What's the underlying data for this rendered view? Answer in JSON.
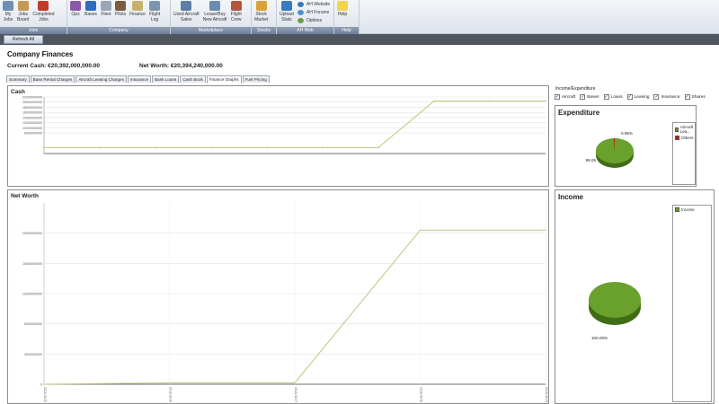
{
  "ribbon": {
    "groups": [
      {
        "label": "Jobs",
        "items": [
          {
            "label": "My\nJobs",
            "icon": "clipboard-icon",
            "color": "#6d8fb5"
          },
          {
            "label": "Jobs\nBoard",
            "icon": "jobs-board-icon",
            "color": "#c79a52"
          },
          {
            "label": "Completed\nJobs",
            "icon": "checkmark-icon",
            "color": "#c23b2a"
          }
        ]
      },
      {
        "label": "Company",
        "items": [
          {
            "label": "Ops",
            "icon": "ops-icon",
            "color": "#8a5aa8"
          },
          {
            "label": "Bases",
            "icon": "globe-icon",
            "color": "#2d6cc0"
          },
          {
            "label": "Fleet",
            "icon": "airplane-icon",
            "color": "#9aa7b8"
          },
          {
            "label": "Pilots",
            "icon": "pilot-icon",
            "color": "#7c5b42"
          },
          {
            "label": "Finance",
            "icon": "money-icon",
            "color": "#c8b26a"
          },
          {
            "label": "Flight\nLog",
            "icon": "logbook-icon",
            "color": "#7d94b3"
          }
        ]
      },
      {
        "label": "Marketplace",
        "items": [
          {
            "label": "Used Aircraft\nSales",
            "icon": "used-aircraft-icon",
            "color": "#5d7fa6"
          },
          {
            "label": "Lease/Buy\nNew Aircraft",
            "icon": "new-aircraft-icon",
            "color": "#6b8db3"
          },
          {
            "label": "Flight\nCrew",
            "icon": "crew-icon",
            "color": "#b5553d"
          }
        ]
      },
      {
        "label": "Stocks",
        "items": [
          {
            "label": "Stock\nMarket",
            "icon": "stock-market-icon",
            "color": "#d9a33a"
          }
        ]
      },
      {
        "label": "AH Web",
        "items": [
          {
            "label": "Upload\nStats",
            "icon": "upload-icon",
            "color": "#3b79c2"
          }
        ],
        "mini": [
          {
            "label": "AH Website",
            "icon": "website-icon",
            "color": "#3b79c2"
          },
          {
            "label": "AH Forums",
            "icon": "forums-icon",
            "color": "#4d8fd0"
          },
          {
            "label": "Options",
            "icon": "options-icon",
            "color": "#6a9a4c"
          }
        ]
      },
      {
        "label": "Help",
        "items": [
          {
            "label": "Help",
            "icon": "lightbulb-icon",
            "color": "#f2d54a"
          }
        ]
      }
    ]
  },
  "toolbar": {
    "refresh_label": "Refresh All"
  },
  "page": {
    "title": "Company Finances",
    "current_cash": "Current Cash: €20,392,000,000.00",
    "net_worth": "Net Worth: €20,394,240,000.00"
  },
  "tabs": [
    "Summary",
    "Base Rental Charges",
    "Aircraft Leasing Charges",
    "Insurance",
    "Bank Loans",
    "Cash Book",
    "Finance Graphs",
    "Fuel Pricing"
  ],
  "active_tab": "Finance Graphs",
  "income_expenditure": {
    "label": "Income/Expenditure",
    "filters": [
      {
        "label": "Aircraft",
        "checked": true
      },
      {
        "label": "Bases",
        "checked": true
      },
      {
        "label": "Loans",
        "checked": true
      },
      {
        "label": "Leasing",
        "checked": true
      },
      {
        "label": "Insurance",
        "checked": true
      },
      {
        "label": "Shares",
        "checked": true
      }
    ]
  },
  "colors": {
    "line": "#b9c97a",
    "pie_green": "#6aa12c",
    "pie_red": "#b01818"
  },
  "chart_data": [
    {
      "type": "line",
      "title": "Cash",
      "x": [
        0,
        1,
        2,
        3,
        4,
        5,
        6,
        7,
        8,
        9
      ],
      "values": [
        2300000000,
        2300000000,
        2300000000,
        2300000000,
        2300000000,
        2300000000,
        2300000000,
        20392000000,
        20392000000,
        20392000000
      ],
      "ylim": [
        0,
        22000000000
      ],
      "yticks": [
        "22000000000",
        "20000000000",
        "18000000000",
        "16000000000",
        "14000000000",
        "12000000000",
        "10000000000",
        "8000000000"
      ],
      "grid": true
    },
    {
      "type": "line",
      "title": "Net Worth",
      "x": [
        0,
        1,
        2,
        3,
        4
      ],
      "values": [
        0,
        180000000,
        180000000,
        20394240000,
        20394240000
      ],
      "ylim": [
        0,
        24000000000
      ],
      "yticks": [
        "20000000000",
        "16000000000",
        "12000000000",
        "8000000000",
        "4000000000",
        "0"
      ],
      "xticks": [
        "2018.08.05",
        "2018.08.06",
        "2018.08.07",
        "2018.08.08",
        "2018.08.09"
      ],
      "grid": true
    },
    {
      "type": "pie",
      "title": "Expenditure",
      "labels": [
        "Aircraft Lea...",
        "Others"
      ],
      "values": [
        99.05,
        0.95
      ],
      "data_labels": [
        "99.05",
        "0.95%"
      ]
    },
    {
      "type": "pie",
      "title": "Income",
      "labels": [
        "Income"
      ],
      "values": [
        100
      ],
      "data_labels": [
        "100.00%"
      ]
    }
  ]
}
